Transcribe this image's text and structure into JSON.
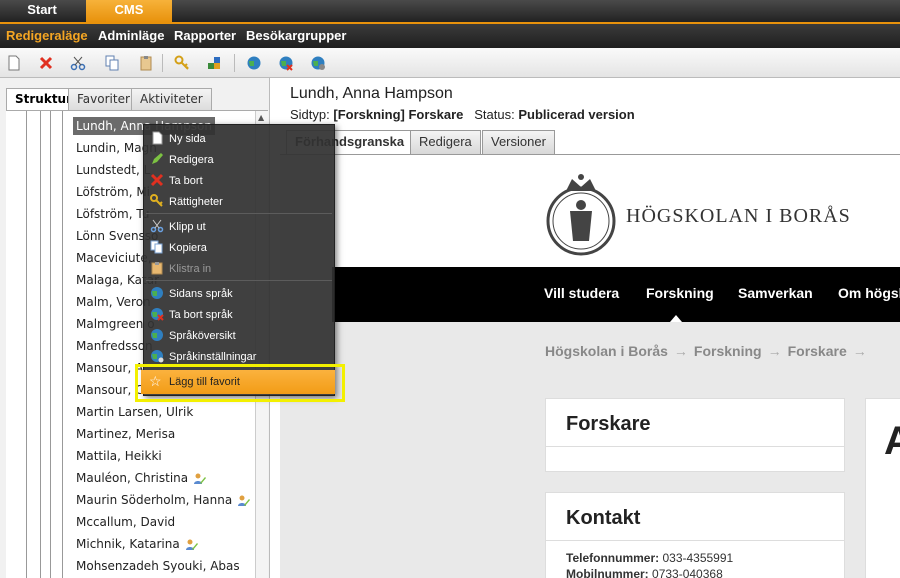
{
  "top_tabs": {
    "start": "Start",
    "cms": "CMS"
  },
  "menu": {
    "items": [
      "Redigeraläge",
      "Adminläge",
      "Rapporter",
      "Besökargrupper"
    ],
    "active_index": 0
  },
  "toolbar": {
    "icons": [
      "new-page-icon",
      "delete-icon",
      "cut-icon",
      "copy-icon",
      "paste-icon",
      "permissions-icon",
      "move-icon",
      "language-icon",
      "remove-language-icon",
      "language-settings-icon"
    ]
  },
  "left_tabs": [
    "Struktur",
    "Favoriter",
    "Aktiviteter"
  ],
  "tree": {
    "items": [
      {
        "label": "Lundh, Anna Hampson",
        "selected": true
      },
      {
        "label": "Lundin, Magn"
      },
      {
        "label": "Lundstedt, L"
      },
      {
        "label": "Löfström, Mi"
      },
      {
        "label": "Löfström, Tu"
      },
      {
        "label": "Lönn Svensso"
      },
      {
        "label": "Maceviciute,"
      },
      {
        "label": "Malaga, Katar"
      },
      {
        "label": "Malm, Veron"
      },
      {
        "label": "Malmgreen o"
      },
      {
        "label": "Manfredsson"
      },
      {
        "label": "Mansour, A"
      },
      {
        "label": "Mansour, C"
      },
      {
        "label": "Martin Larsen, Ulrik"
      },
      {
        "label": "Martinez, Merisa"
      },
      {
        "label": "Mattila, Heikki"
      },
      {
        "label": "Mauléon, Christina",
        "edit_icon": true
      },
      {
        "label": "Maurin Söderholm, Hanna",
        "edit_icon": true
      },
      {
        "label": "Mccallum, David"
      },
      {
        "label": "Michnik, Katarina",
        "edit_icon": true
      },
      {
        "label": "Mohsenzadeh Syouki, Abas"
      }
    ]
  },
  "page": {
    "title": "Lundh, Anna Hampson",
    "sidtyp_label": "Sidtyp:",
    "sidtyp_value": "[Forskning] Forskare",
    "status_label": "Status:",
    "status_value": "Publicerad version"
  },
  "right_tabs": [
    "Förhandsgranska",
    "Redigera",
    "Versioner"
  ],
  "preview": {
    "logo_text": "HÖGSKOLAN I BORÅS",
    "nav": [
      "Vill studera",
      "Forskning",
      "Samverkan",
      "Om högsko"
    ],
    "breadcrumb": [
      "Högskolan i Borås",
      "Forskning",
      "Forskare"
    ],
    "breadcrumb_sep": "→",
    "card_forskare": "Forskare",
    "card_kontakt": "Kontakt",
    "big_card_letter": "A",
    "telefon_label": "Telefonnummer:",
    "telefon_value": "033-4355991",
    "mobil_label": "Mobilnummer:",
    "mobil_value": "0733-040368"
  },
  "context_menu": {
    "items": [
      {
        "label": "Ny sida",
        "icon": "new-page-icon"
      },
      {
        "label": "Redigera",
        "icon": "edit-icon"
      },
      {
        "label": "Ta bort",
        "icon": "delete-icon"
      },
      {
        "label": "Rättigheter",
        "icon": "key-icon"
      },
      {
        "label": "Klipp ut",
        "icon": "cut-icon"
      },
      {
        "label": "Kopiera",
        "icon": "copy-icon"
      },
      {
        "label": "Klistra in",
        "icon": "paste-icon",
        "disabled": true
      },
      {
        "label": "Sidans språk",
        "icon": "globe-icon"
      },
      {
        "label": "Ta bort språk",
        "icon": "globe-delete-icon"
      },
      {
        "label": "Språköversikt",
        "icon": "globe-overview-icon"
      },
      {
        "label": "Språkinställningar",
        "icon": "globe-settings-icon"
      }
    ],
    "favorite": {
      "label": "Lägg till favorit",
      "icon": "star-icon"
    }
  },
  "colors": {
    "accent": "#f29c16",
    "highlight": "#f3f000"
  }
}
